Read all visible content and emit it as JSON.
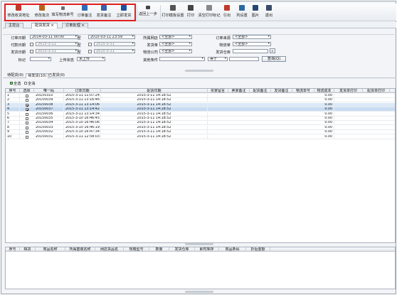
{
  "toolbar": {
    "buttons": [
      {
        "label": "修改收货地址",
        "icon": "edit-address-icon"
      },
      {
        "label": "修改批次",
        "icon": "edit-batch-icon"
      },
      {
        "label": "填写物流单号",
        "icon": "fill-tracking-icon"
      },
      {
        "label": "订单备注",
        "icon": "order-note-icon"
      },
      {
        "label": "发货备注",
        "icon": "ship-note-icon"
      },
      {
        "label": "立即发货",
        "icon": "ship-now-icon"
      },
      {
        "label": "返回上一步",
        "icon": "back-step-icon"
      },
      {
        "label": "打印模板设置",
        "icon": "print-template-icon"
      },
      {
        "label": "打印",
        "icon": "printer-icon"
      },
      {
        "label": "清空打印标记",
        "icon": "clear-print-mark-icon"
      },
      {
        "label": "引出",
        "icon": "export-icon"
      },
      {
        "label": "列设置",
        "icon": "column-settings-icon"
      },
      {
        "label": "图片",
        "icon": "image-icon"
      },
      {
        "label": "退出",
        "icon": "exit-icon"
      }
    ]
  },
  "tabs": [
    {
      "label": "主控台"
    },
    {
      "label": "配货发货"
    },
    {
      "label": "订单处理"
    }
  ],
  "form": {
    "order_date_label": "订单日期",
    "order_date_from": "2014-03-11 00:00",
    "to_label": "至",
    "order_date_to": "2015-03-11 23:59",
    "store_label": "所属网店",
    "store_value": "<全部>",
    "order_source_label": "订单来源",
    "order_source_value": "<全部>",
    "pay_date_label": "付款日期",
    "pay_date_from": "2015-3-11",
    "pay_date_to": "2015-3-11",
    "ship_type_label": "发货单",
    "ship_type_value": "<全部>",
    "logistics_no_label": "物流单",
    "logistics_no_value": "<全部>",
    "ship_date_label": "发货日期",
    "ship_date_from": "2015-3-11",
    "ship_date_to": "2015-3-11",
    "logistics_co_label": "物流公司",
    "logistics_co_value": "<全部>",
    "warehouse_label": "发货仓库",
    "warehouse_value": "",
    "mark_label": "标记",
    "mark_value": "",
    "upload_label": "上传状态",
    "upload_value": "未上传",
    "other_label": "其他条件",
    "other_value": "",
    "op_value": "等于",
    "op_input": "",
    "query_label": "查询(Q)"
  },
  "list_tabs": [
    {
      "label": "待配货(0)"
    },
    {
      "label": "待发货(10)"
    },
    {
      "label": "已发货(0)"
    }
  ],
  "selection": {
    "all_label": "全选",
    "none_label": "全消"
  },
  "grid": {
    "columns": [
      "序号",
      "选择",
      "唯一码",
      "订单日期",
      "配货日期",
      "买家留言",
      "卖家备注",
      "配货备注",
      "发货备注",
      "物流单号",
      "物流成本",
      "发货单打印",
      "配货单打印"
    ],
    "rows": [
      {
        "no": "1",
        "checked": false,
        "code": "20150310",
        "order_date": "2015-3-11 11:07:24",
        "alloc_date": "2015-3-11 14:18:52",
        "cost": "0.00"
      },
      {
        "no": "2",
        "checked": false,
        "code": "20150039",
        "order_date": "2015-3-11 13:16:46",
        "alloc_date": "2015-3-11 14:18:52",
        "cost": "0.00"
      },
      {
        "no": "3",
        "checked": true,
        "code": "20150038",
        "order_date": "2015-3-11 13:14:06",
        "alloc_date": "2015-3-11 14:18:52",
        "cost": "0.00"
      },
      {
        "no": "4",
        "checked": true,
        "code": "20150037",
        "order_date": "2015-3-11 13:14:42",
        "alloc_date": "2015-3-11 14:18:52",
        "cost": "0.00"
      },
      {
        "no": "5",
        "checked": false,
        "code": "20150036",
        "order_date": "2015-3-11 13:14:34",
        "alloc_date": "2015-3-11 14:18:52",
        "cost": "0.00"
      },
      {
        "no": "6",
        "checked": false,
        "code": "20150035",
        "order_date": "2015-3-10 16:46:45",
        "alloc_date": "2015-3-11 14:18:52",
        "cost": "0.00"
      },
      {
        "no": "7",
        "checked": false,
        "code": "20150034",
        "order_date": "2015-3-10 16:46:06",
        "alloc_date": "2015-3-11 14:18:52",
        "cost": "0.00"
      },
      {
        "no": "8",
        "checked": false,
        "code": "20150033",
        "order_date": "2015-3-10 16:46:19",
        "alloc_date": "2015-3-11 14:18:52",
        "cost": "0.00"
      },
      {
        "no": "9",
        "checked": false,
        "code": "20150032",
        "order_date": "2015-3-10 16:47:34",
        "alloc_date": "2015-3-11 14:18:52",
        "cost": "0.00"
      },
      {
        "no": "10",
        "checked": false,
        "code": "20150031",
        "order_date": "2015-3-11 12:58:03",
        "alloc_date": "2015-3-11 14:18:52",
        "cost": "0.00"
      }
    ]
  },
  "detail": {
    "columns": [
      "序号",
      "缺货",
      "商品名称",
      "所属套装名称",
      "网店货品名",
      "规格型号",
      "数量",
      "发货仓库",
      "即时库存",
      "商品条码",
      "折后金额"
    ]
  }
}
